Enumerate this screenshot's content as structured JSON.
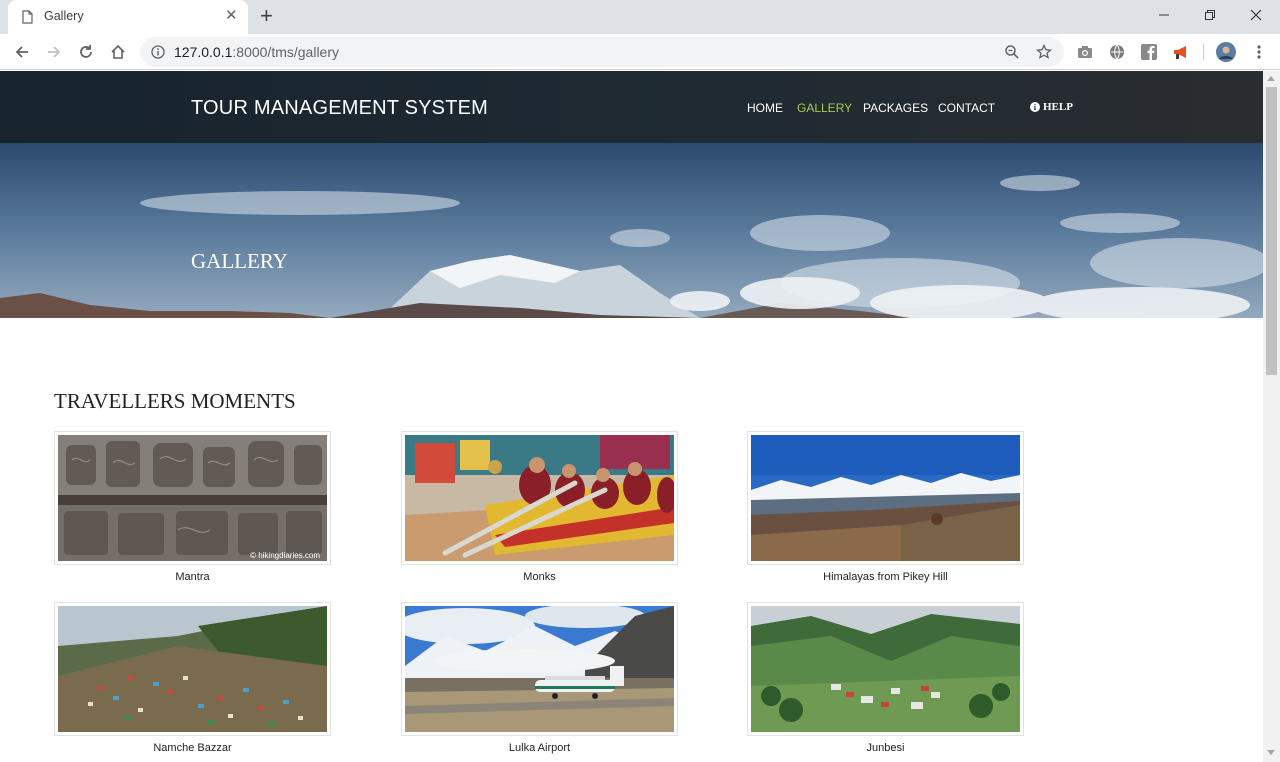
{
  "browser": {
    "tab_title": "Gallery",
    "url_host": "127.0.0.1",
    "url_rest": ":8000/tms/gallery"
  },
  "site": {
    "brand": "TOUR MANAGEMENT SYSTEM",
    "nav": [
      "HOME",
      "GALLERY",
      "PACKAGES",
      "CONTACT"
    ],
    "active_nav": "GALLERY",
    "help": "HELP",
    "accent": "#a7c94a"
  },
  "hero": {
    "title": "GALLERY"
  },
  "gallery": {
    "title": "TRAVELLERS MOMENTS",
    "items": [
      {
        "caption": "Mantra",
        "watermark": "© hikingdiaries.com"
      },
      {
        "caption": "Monks"
      },
      {
        "caption": "Himalayas from Pikey Hill"
      },
      {
        "caption": "Namche Bazzar"
      },
      {
        "caption": "Lulka Airport"
      },
      {
        "caption": "Junbesi"
      }
    ]
  }
}
